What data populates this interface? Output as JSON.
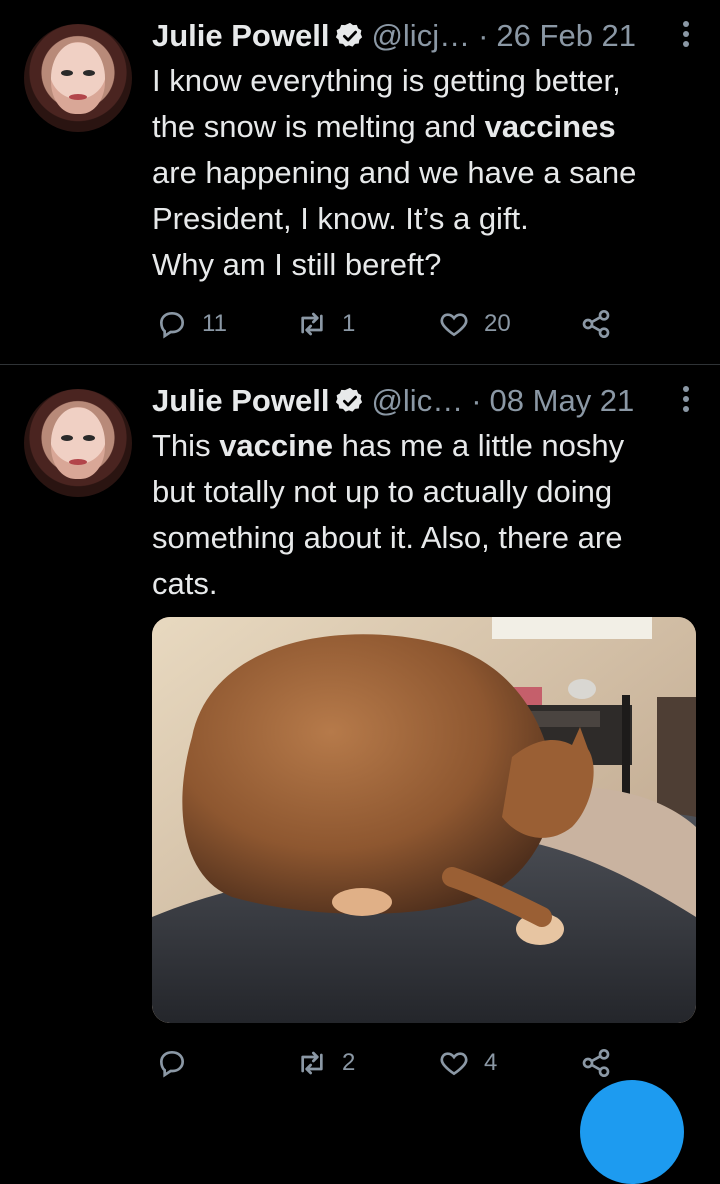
{
  "tweets": [
    {
      "author": "Julie Powell",
      "handle": "@licj…",
      "date": "26 Feb 21",
      "text_lines": [
        {
          "a": "I know everything is getting better,",
          "b": "",
          "c": ""
        },
        {
          "a": "the snow is melting and ",
          "b": "vaccines",
          "c": ""
        },
        {
          "a": "are happening and we have a sane",
          "b": "",
          "c": ""
        },
        {
          "a": "President, I know. It’s a gift.",
          "b": "",
          "c": ""
        },
        {
          "a": "Why am I still bereft?",
          "b": "",
          "c": ""
        }
      ],
      "replies": "11",
      "retweets": "1",
      "likes": "20"
    },
    {
      "author": "Julie Powell",
      "handle": "@lic…",
      "date": "08 May 21",
      "text_lines": [
        {
          "a": "This ",
          "b": "vaccine",
          "c": " has me a little noshy"
        },
        {
          "a": "but totally not up to actually doing",
          "b": "",
          "c": ""
        },
        {
          "a": "something about it. Also, there are",
          "b": "",
          "c": ""
        },
        {
          "a": "cats.",
          "b": "",
          "c": ""
        }
      ],
      "replies": "",
      "retweets": "2",
      "likes": "4"
    }
  ],
  "colors": {
    "background": "#000000",
    "text": "#e7e9ea",
    "muted": "#8b98a5",
    "divider": "#2f3336",
    "accent": "#1d9bf0"
  },
  "icons": {
    "more": "more-vertical-icon",
    "reply": "reply-icon",
    "retweet": "retweet-icon",
    "like": "like-icon",
    "share": "share-icon",
    "verified": "verified-icon"
  }
}
